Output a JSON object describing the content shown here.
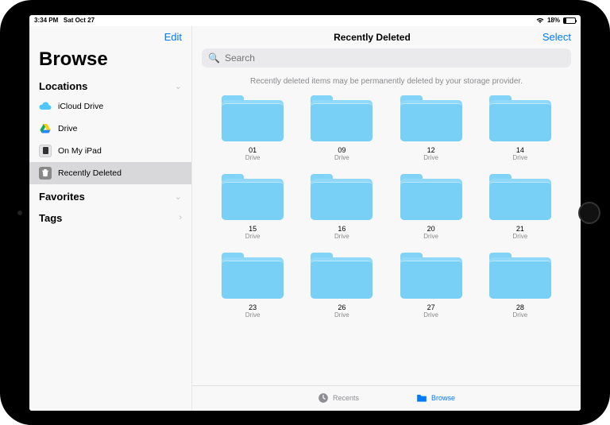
{
  "status": {
    "time": "3:34 PM",
    "date": "Sat Oct 27",
    "battery_pct": "18%"
  },
  "sidebar": {
    "edit_label": "Edit",
    "browse_title": "Browse",
    "sections": {
      "locations_label": "Locations",
      "favorites_label": "Favorites",
      "tags_label": "Tags"
    },
    "locations": [
      {
        "label": "iCloud Drive"
      },
      {
        "label": "Drive"
      },
      {
        "label": "On My iPad"
      },
      {
        "label": "Recently Deleted"
      }
    ]
  },
  "main": {
    "title": "Recently Deleted",
    "select_label": "Select",
    "search_placeholder": "Search",
    "notice": "Recently deleted items may be permanently deleted by your storage provider.",
    "folder_sub": "Drive",
    "folders": [
      {
        "name": "01"
      },
      {
        "name": "09"
      },
      {
        "name": "12"
      },
      {
        "name": "14"
      },
      {
        "name": "15"
      },
      {
        "name": "16"
      },
      {
        "name": "20"
      },
      {
        "name": "21"
      },
      {
        "name": "23"
      },
      {
        "name": "26"
      },
      {
        "name": "27"
      },
      {
        "name": "28"
      }
    ]
  },
  "tabbar": {
    "recents_label": "Recents",
    "browse_label": "Browse"
  }
}
